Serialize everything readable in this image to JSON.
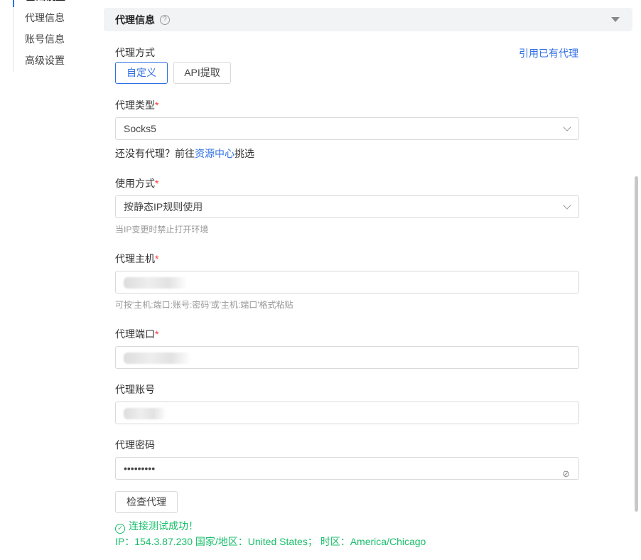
{
  "sidebar": {
    "items": [
      {
        "label": "基础设置",
        "active": true
      },
      {
        "label": "代理信息"
      },
      {
        "label": "账号信息"
      },
      {
        "label": "高级设置"
      }
    ]
  },
  "section": {
    "title": "代理信息",
    "help_icon": "question-circle-icon"
  },
  "proxy_mode": {
    "label": "代理方式",
    "options": [
      "自定义",
      "API提取"
    ],
    "selected": "自定义",
    "use_existing": "引用已有代理"
  },
  "proxy_type": {
    "label": "代理类型",
    "required": "*",
    "value": "Socks5",
    "hint_prefix": "还没有代理？前往",
    "hint_link": "资源中心",
    "hint_suffix": "挑选"
  },
  "usage": {
    "label": "使用方式",
    "required": "*",
    "value": "按静态IP规则使用",
    "hint": "当IP变更时禁止打开环境"
  },
  "host": {
    "label": "代理主机",
    "required": "*",
    "hint": "可按'主机:端口:账号:密码'或'主机:端口'格式粘贴"
  },
  "port": {
    "label": "代理端口",
    "required": "*"
  },
  "account": {
    "label": "代理账号"
  },
  "password": {
    "label": "代理密码",
    "value": "•••••••••"
  },
  "check_button": "检查代理",
  "result": {
    "status": "连接测试成功！",
    "ip_label": "IP：",
    "ip": "154.3.87.230",
    "country_label": "国家/地区：",
    "country": "United States；",
    "tz_label": "时区：",
    "timezone": "America/Chicago",
    "color": "#19be6b"
  },
  "colors": {
    "accent": "#2f6fe6",
    "required": "#ff3333"
  }
}
